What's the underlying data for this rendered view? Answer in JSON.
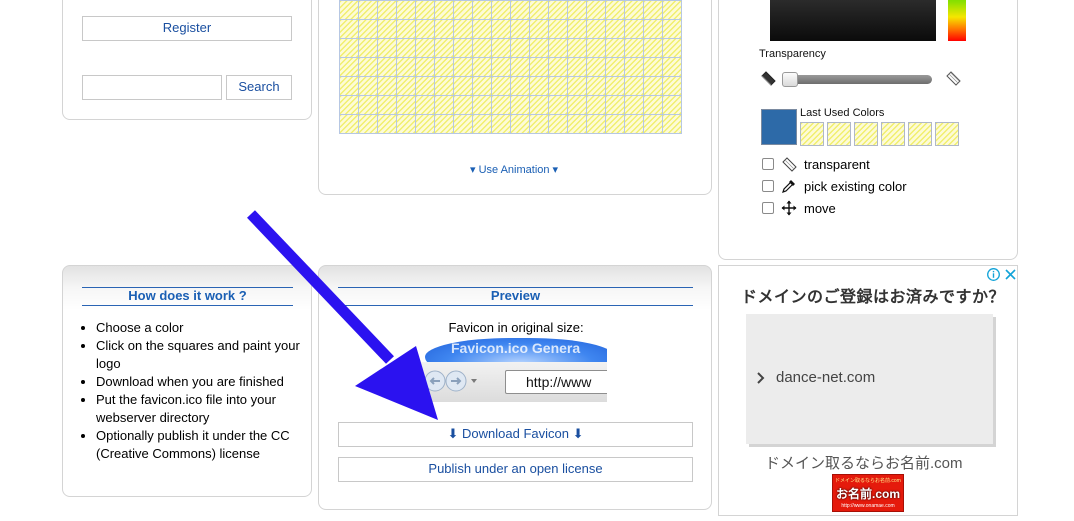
{
  "account": {
    "register_label": "Register",
    "search_value": "",
    "search_button": "Search"
  },
  "editor": {
    "grid_rows": 8,
    "grid_cols": 18,
    "use_animation_label": "▾ Use Animation ▾"
  },
  "color_picker": {
    "transparency_label": "Transparency",
    "transparency_value": 0,
    "last_used_label": "Last Used Colors",
    "current_color": "#2d6aa8",
    "last_used_count": 6,
    "options": {
      "transparent": "transparent",
      "pick": "pick existing color",
      "move": "move"
    }
  },
  "how": {
    "title": "How does it work ?",
    "steps": [
      "Choose a color",
      "Click on the squares and paint your logo",
      "Download when you are finished",
      "Put the favicon.ico file into your webserver directory",
      "Optionally publish it under the CC (Creative Commons) license"
    ]
  },
  "preview": {
    "title": "Preview",
    "original_size_label": "Favicon in original size:",
    "browser_tab_text": "Favicon.ico Genera",
    "browser_url_text": "http://www",
    "download_label": "⬇ Download Favicon ⬇",
    "publish_label": "Publish under an open license"
  },
  "ad": {
    "title": "ドメインのご登録はお済みですか？",
    "link_text": "dance-net.com",
    "sub_text": "ドメイン取るならお名前.com",
    "logo_text": "お名前.com",
    "logo_top_text": "ドメイン取るならお名前.com",
    "logo_url_text": "http://www.onamae.com"
  },
  "colors": {
    "accent": "#1a5fb4",
    "annotation_arrow": "#2b12f0"
  }
}
